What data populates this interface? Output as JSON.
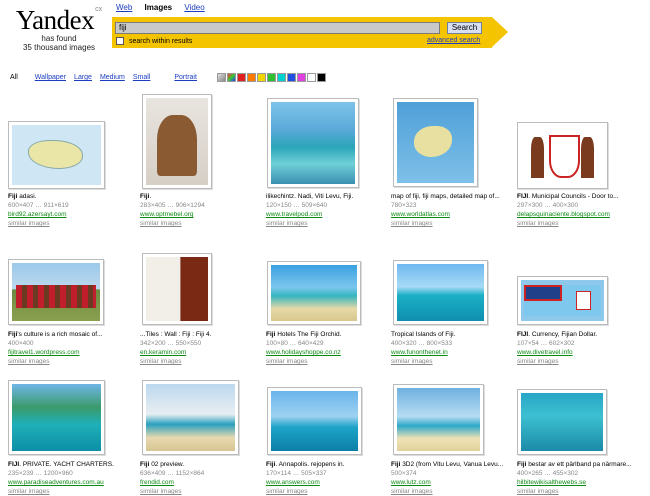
{
  "logo": {
    "wordmark": "Yandex",
    "superscript": "cx",
    "line1": "has found",
    "line2": "35 thousand images"
  },
  "services": [
    "Web",
    "Images",
    "Video"
  ],
  "search": {
    "query": "fiji",
    "button": "Search",
    "within": "search within results",
    "advanced": "advanced search"
  },
  "filters": {
    "all": "All",
    "items": [
      "Wallpaper",
      "Large",
      "Medium",
      "Small"
    ],
    "portrait": "Portrait",
    "colors": [
      "#aaaaaa",
      "#4b9be8",
      "#e02020",
      "#ff7a00",
      "#f0d400",
      "#2fbf2f",
      "#00d0d0",
      "#2050e0",
      "#e040e0",
      "#ffffff",
      "#000000"
    ]
  },
  "results": [
    {
      "title_b": "Fiji",
      "title": " adasi.",
      "dims": "600×407 … 911×619",
      "site": "bird92.azersayt.com",
      "similar": "similar images"
    },
    {
      "title_b": "Fiji",
      "title": ".",
      "dims": "283×405 … 906×1294",
      "site": "www.optmebel.org",
      "similar": "similar images"
    },
    {
      "title_b": "",
      "title": "ilikechintz. Nadi, Viti Levu, Fiji.",
      "dims": "120×150 … 509×640",
      "site": "www.travelpod.com",
      "similar": "similar images"
    },
    {
      "title_b": "",
      "title": "map of fiji, fiji maps, detailed map of...",
      "dims": "780×323",
      "site": "www.worldatlas.com",
      "similar": "similar images"
    },
    {
      "title_b": "FIJI",
      "title": ". Municipal Councils - Door to...",
      "dims": "297×300 … 400×300",
      "site": "delapsquinaciente.blogspot.com",
      "similar": "similar images"
    },
    {
      "title_b": "Fiji",
      "title": "'s culture is a rich mosaic of...",
      "dims": "400×400",
      "site": "fijitravel1.wordpress.com",
      "similar": "similar images"
    },
    {
      "title_b": "",
      "title": "...Tiles : Wall : Fiji : Fiji 4.",
      "dims": "342×200 … 550×550",
      "site": "en.keramin.com",
      "similar": "similar images"
    },
    {
      "title_b": "Fiji",
      "title": " Hotels The Fiji Orchid.",
      "dims": "100×80 … 640×429",
      "site": "www.holidayshoppe.co.nz",
      "similar": "similar images"
    },
    {
      "title_b": "",
      "title": "Tropical Islands of Fiji.",
      "dims": "400×320 … 800×533",
      "site": "www.funonthenet.in",
      "similar": "similar images"
    },
    {
      "title_b": "FIJI",
      "title": ". Currency, Fijian Dollar.",
      "dims": "107×54 … 602×302",
      "site": "www.divetravel.info",
      "similar": "similar images"
    },
    {
      "title_b": "FIJI",
      "title": ". PRIVATE. YACHT CHARTERS.",
      "dims": "235×239 … 1200×960",
      "site": "www.paradiseadventures.com.au",
      "similar": "similar images"
    },
    {
      "title_b": "Fiji",
      "title": " 02 preview.",
      "dims": "636×409 … 1152×864",
      "site": "frendid.com",
      "similar": "similar images"
    },
    {
      "title_b": "Fiji",
      "title": ". Annapolis. rejopens in.",
      "dims": "170×114 … 505×337",
      "site": "www.answers.com",
      "similar": "similar images"
    },
    {
      "title_b": "Fiji",
      "title": " 3D2 (from Vitu Levu, Vanua Levu...",
      "dims": "500×374",
      "site": "www.lutz.com",
      "similar": "similar images"
    },
    {
      "title_b": "Fiji",
      "title": " bestar av ett pärlband pa närmare...",
      "dims": "400×265 … 455×302",
      "site": "hilbitewikisalthewebs.se",
      "similar": "similar images"
    }
  ]
}
